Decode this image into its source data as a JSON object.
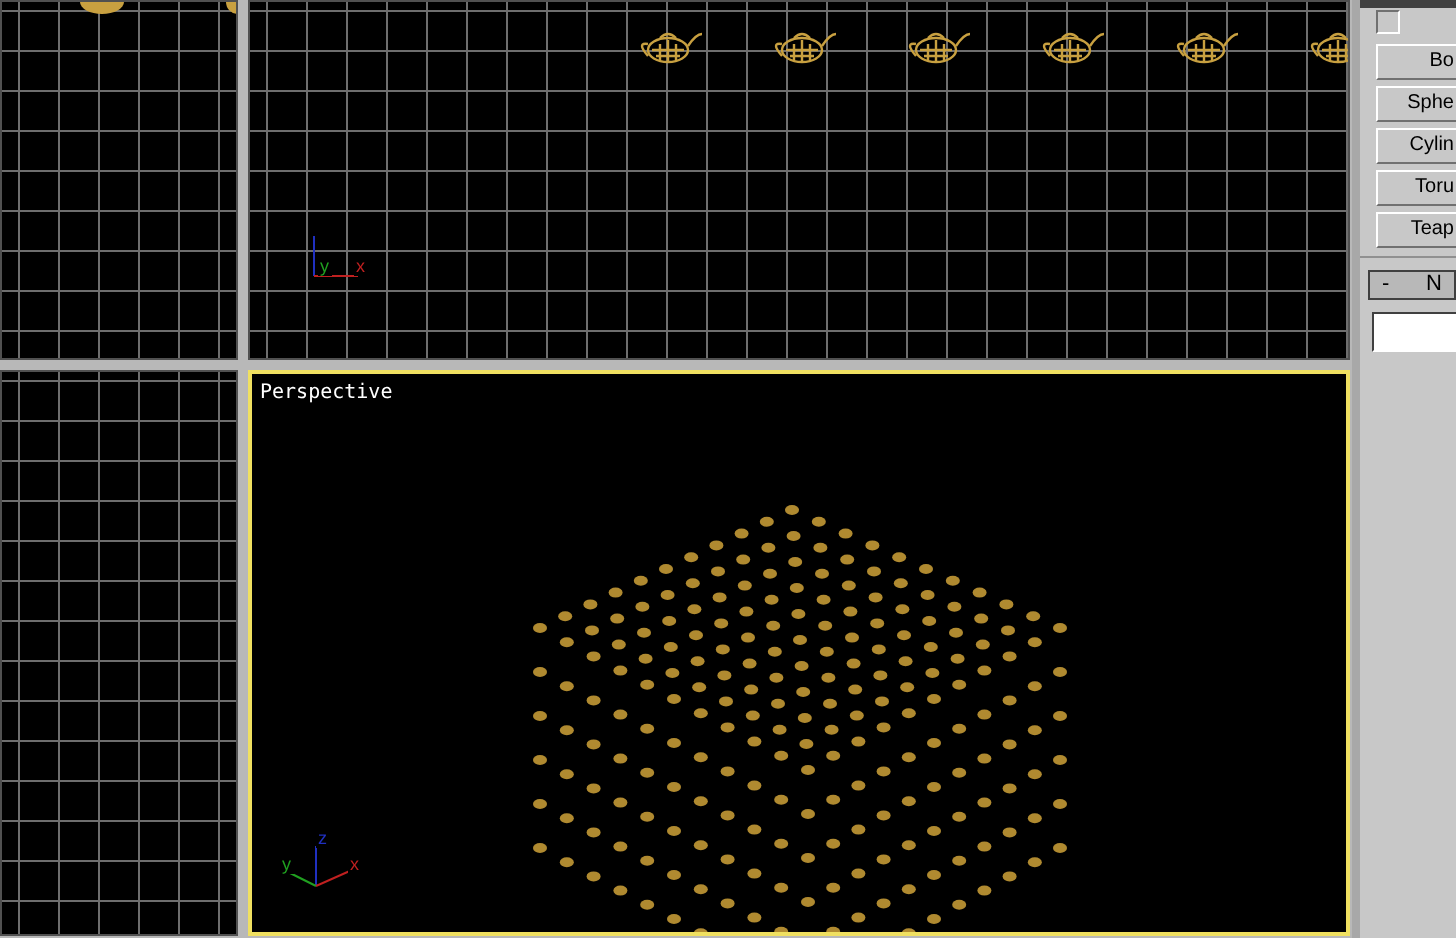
{
  "viewports": [
    {
      "kind": "edge-teapots-grid",
      "active": false
    },
    {
      "kind": "teapot-row-grid",
      "active": false,
      "axis_labels": [
        "y",
        "x"
      ]
    },
    {
      "kind": "empty-grid",
      "active": false
    },
    {
      "kind": "perspective",
      "active": true,
      "label": "Perspective",
      "axis_labels": [
        "z",
        "y",
        "x"
      ]
    }
  ],
  "command_panel": {
    "checkbox": {
      "checked": false
    },
    "buttons": [
      "Bo",
      "Sphe",
      "Cylin",
      "Toru",
      "Teap"
    ],
    "rollout": {
      "toggle": "-",
      "title": "N"
    }
  }
}
